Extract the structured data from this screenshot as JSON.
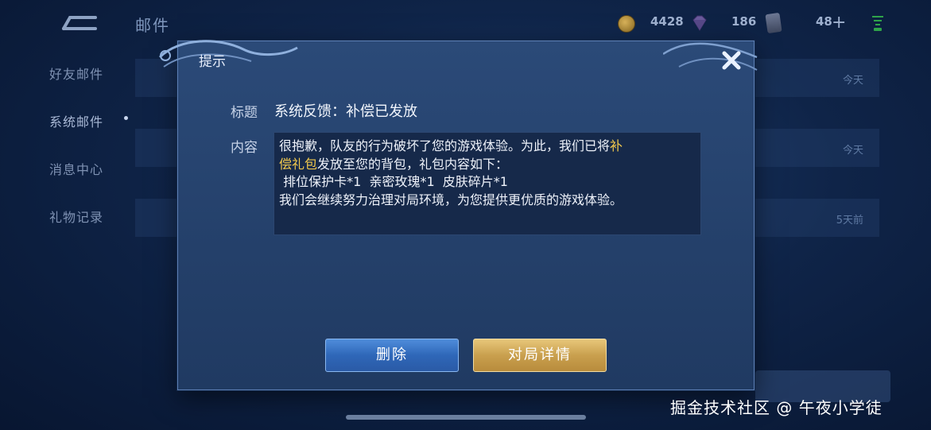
{
  "header": {
    "title": "邮件",
    "gold": "4428",
    "gems": "186",
    "cards": "48"
  },
  "sidebar": {
    "items": [
      {
        "label": "好友邮件"
      },
      {
        "label": "系统邮件"
      },
      {
        "label": "消息中心"
      },
      {
        "label": "礼物记录"
      }
    ]
  },
  "list": {
    "dates": [
      "今天",
      "今天",
      "5天前"
    ]
  },
  "dialog": {
    "title": "提示",
    "subject_label": "标题",
    "subject": "系统反馈：补偿已发放",
    "content_label": "内容",
    "content_line1_a": "很抱歉，队友的行为破坏了您的游戏体验。为此，我们已将",
    "content_line1_hl": "补",
    "content_line2_hl": "偿礼包",
    "content_line2_b": "发放至您的背包，礼包内容如下：",
    "content_line3": " 排位保护卡*1  亲密玫瑰*1  皮肤碎片*1",
    "content_line4": "我们会继续努力治理对局环境，为您提供更优质的游戏体验。",
    "delete_label": "删除",
    "detail_label": "对局详情"
  },
  "watermark": "掘金技术社区 @ 午夜小学徒",
  "colors": {
    "highlight": "#f2c94c",
    "delete_button": "#3a77c8",
    "detail_button": "#d1aa5a"
  },
  "icons": [
    "back-arrow-icon",
    "coin-icon",
    "gem-icon",
    "card-icon",
    "plus-icon",
    "signal-icon",
    "close-icon"
  ]
}
